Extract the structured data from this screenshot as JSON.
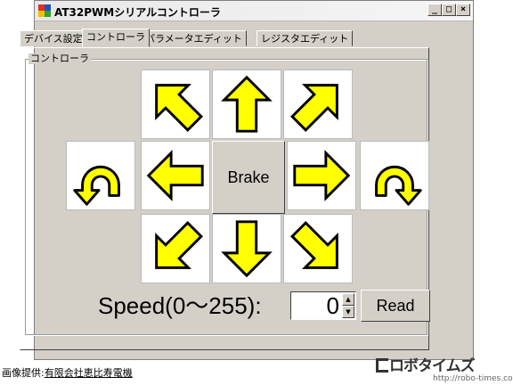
{
  "window": {
    "title": "AT32PWMシリアルコントローラ",
    "minimize_label": "_",
    "maximize_label": "□",
    "close_label": "×"
  },
  "tabs": [
    {
      "label": "デバイス設定",
      "active": false
    },
    {
      "label": "コントローラ",
      "active": true
    },
    {
      "label": "パラメータエディット",
      "active": false
    },
    {
      "label": "レジスタエディット",
      "active": false
    }
  ],
  "controller": {
    "group_label": "コントローラ",
    "buttons": [
      "forward-left",
      "forward",
      "forward-right",
      "rotate-left",
      "left",
      "right",
      "rotate-right",
      "back-left",
      "back",
      "back-right"
    ],
    "brake_label": "Brake",
    "speed_label": "Speed(0～255):",
    "speed_value": "0",
    "read_label": "Read"
  },
  "colors": {
    "arrow_fill": "#ffff00",
    "arrow_stroke": "#000000",
    "window_bg": "#d4d0c8"
  },
  "footer": {
    "credit_prefix": "画像提供:",
    "credit_link": "有限会社恵比寿電機",
    "logo_text": "ロボタイムズ",
    "logo_url": "http://robo-times.com/"
  }
}
